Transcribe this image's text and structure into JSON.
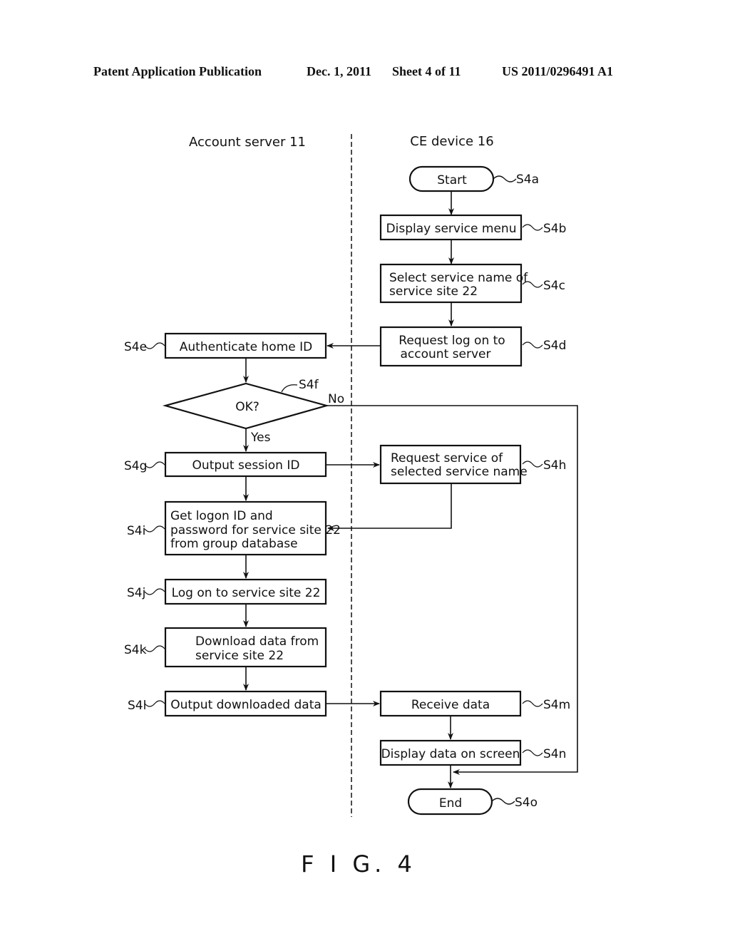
{
  "header": {
    "publication": "Patent Application Publication",
    "date": "Dec. 1, 2011",
    "sheet": "Sheet 4 of 11",
    "number": "US 2011/0296491 A1"
  },
  "lanes": {
    "left": "Account server 11",
    "right": "CE device 16"
  },
  "steps": {
    "s4a": {
      "id": "S4a",
      "lines": [
        "Start"
      ]
    },
    "s4b": {
      "id": "S4b",
      "lines": [
        "Display service menu"
      ]
    },
    "s4c": {
      "id": "S4c",
      "lines": [
        "Select service name of",
        "service site 22"
      ]
    },
    "s4d": {
      "id": "S4d",
      "lines": [
        "Request log on to",
        "account server"
      ]
    },
    "s4e": {
      "id": "S4e",
      "lines": [
        "Authenticate home ID"
      ]
    },
    "s4f": {
      "id": "S4f",
      "lines": [
        "OK?"
      ]
    },
    "s4g": {
      "id": "S4g",
      "lines": [
        "Output session ID"
      ]
    },
    "s4h": {
      "id": "S4h",
      "lines": [
        "Request service of",
        "selected service name"
      ]
    },
    "s4i": {
      "id": "S4i",
      "lines": [
        "Get  logon ID and",
        "password for service site 22",
        "from group database"
      ]
    },
    "s4j": {
      "id": "S4j",
      "lines": [
        "Log on to service site 22"
      ]
    },
    "s4k": {
      "id": "S4k",
      "lines": [
        "Download data from",
        "service site 22"
      ]
    },
    "s4l": {
      "id": "S4l",
      "lines": [
        "Output downloaded data"
      ]
    },
    "s4m": {
      "id": "S4m",
      "lines": [
        "Receive data"
      ]
    },
    "s4n": {
      "id": "S4n",
      "lines": [
        "Display data on screen"
      ]
    },
    "s4o": {
      "id": "S4o",
      "lines": [
        "End"
      ]
    }
  },
  "branches": {
    "yes": "Yes",
    "no": "No"
  },
  "figure_label": "F I G. 4"
}
